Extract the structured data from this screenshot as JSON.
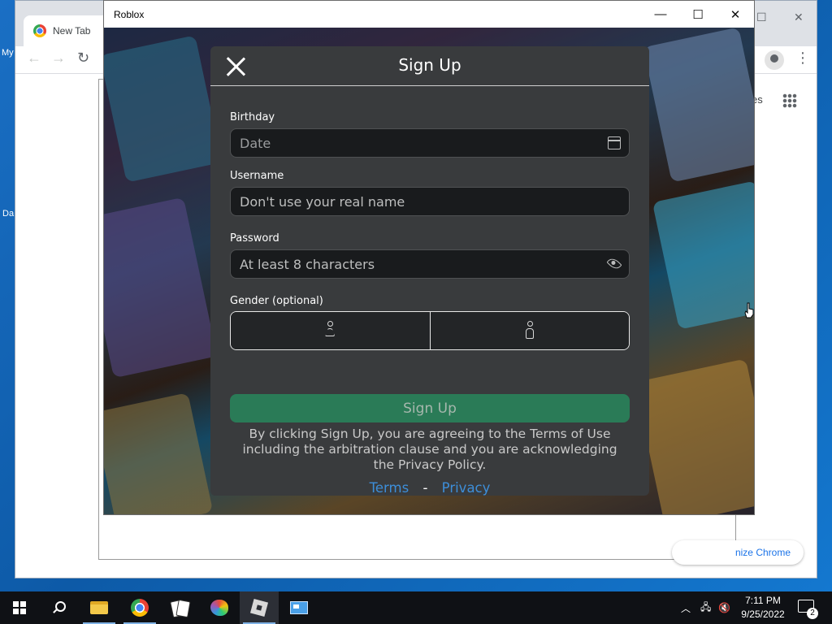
{
  "desktop": {
    "icon_fragments": [
      "My",
      "Da"
    ]
  },
  "chrome": {
    "tab_title": "New Tab",
    "images_fragment": "es",
    "customize_label": "nize Chrome"
  },
  "roblox_window": {
    "title": "Roblox",
    "minimize": "—",
    "maximize": "☐",
    "close": "✕"
  },
  "signup": {
    "title": "Sign Up",
    "birthday_label": "Birthday",
    "birthday_placeholder": "Date",
    "username_label": "Username",
    "username_placeholder": "Don't use your real name",
    "password_label": "Password",
    "password_placeholder": "At least 8 characters",
    "gender_label": "Gender (optional)",
    "button_label": "Sign Up",
    "legal_text": "By clicking Sign Up, you are agreeing to the Terms of Use including the arbitration clause and you are acknowledging the Privacy Policy.",
    "terms_link": "Terms",
    "separator": "-",
    "privacy_link": "Privacy"
  },
  "taskbar": {
    "time": "7:11 PM",
    "date": "9/25/2022",
    "notification_count": "2"
  },
  "colors": {
    "modal_bg": "#393b3d",
    "signup_button": "#2a7b57",
    "link": "#3d8ed9"
  }
}
